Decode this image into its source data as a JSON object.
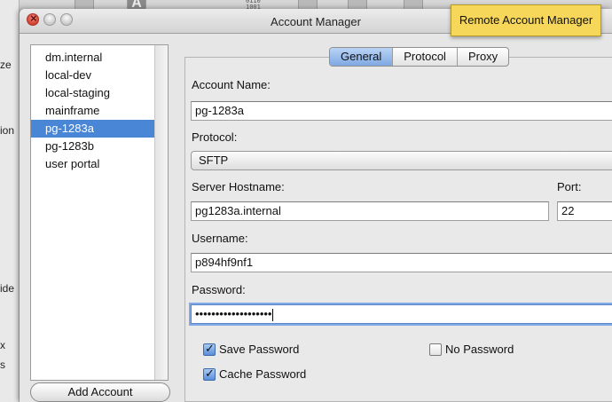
{
  "background_app": {
    "fragments": [
      "ze",
      "ion",
      "ide",
      "x",
      "s"
    ]
  },
  "window": {
    "title": "Account Manager"
  },
  "tooltip": {
    "text": "Remote Account Manager"
  },
  "accounts": {
    "items": [
      "dm.internal",
      "local-dev",
      "local-staging",
      "mainframe",
      "pg-1283a",
      "pg-1283b",
      "user portal"
    ],
    "selected_index": 4,
    "add_label": "Add Account"
  },
  "tabs": {
    "items": [
      "General",
      "Protocol",
      "Proxy"
    ],
    "active": "General"
  },
  "form": {
    "account_name_label": "Account Name:",
    "account_name_value": "pg-1283a",
    "protocol_label": "Protocol:",
    "protocol_value": "SFTP",
    "hostname_label": "Server Hostname:",
    "hostname_value": "pg1283a.internal",
    "port_label": "Port:",
    "port_value": "22",
    "username_label": "Username:",
    "username_value": "p894hf9nf1",
    "password_label": "Password:",
    "password_value": "•••••••••••••••••••",
    "save_password_label": "Save Password",
    "save_password_checked": true,
    "no_password_label": "No Password",
    "no_password_checked": false,
    "cache_password_label": "Cache Password",
    "cache_password_checked": true
  },
  "colors": {
    "selection": "#4a86d6",
    "tooltip": "#f7d75a",
    "active_tab": "#9bbeed"
  }
}
